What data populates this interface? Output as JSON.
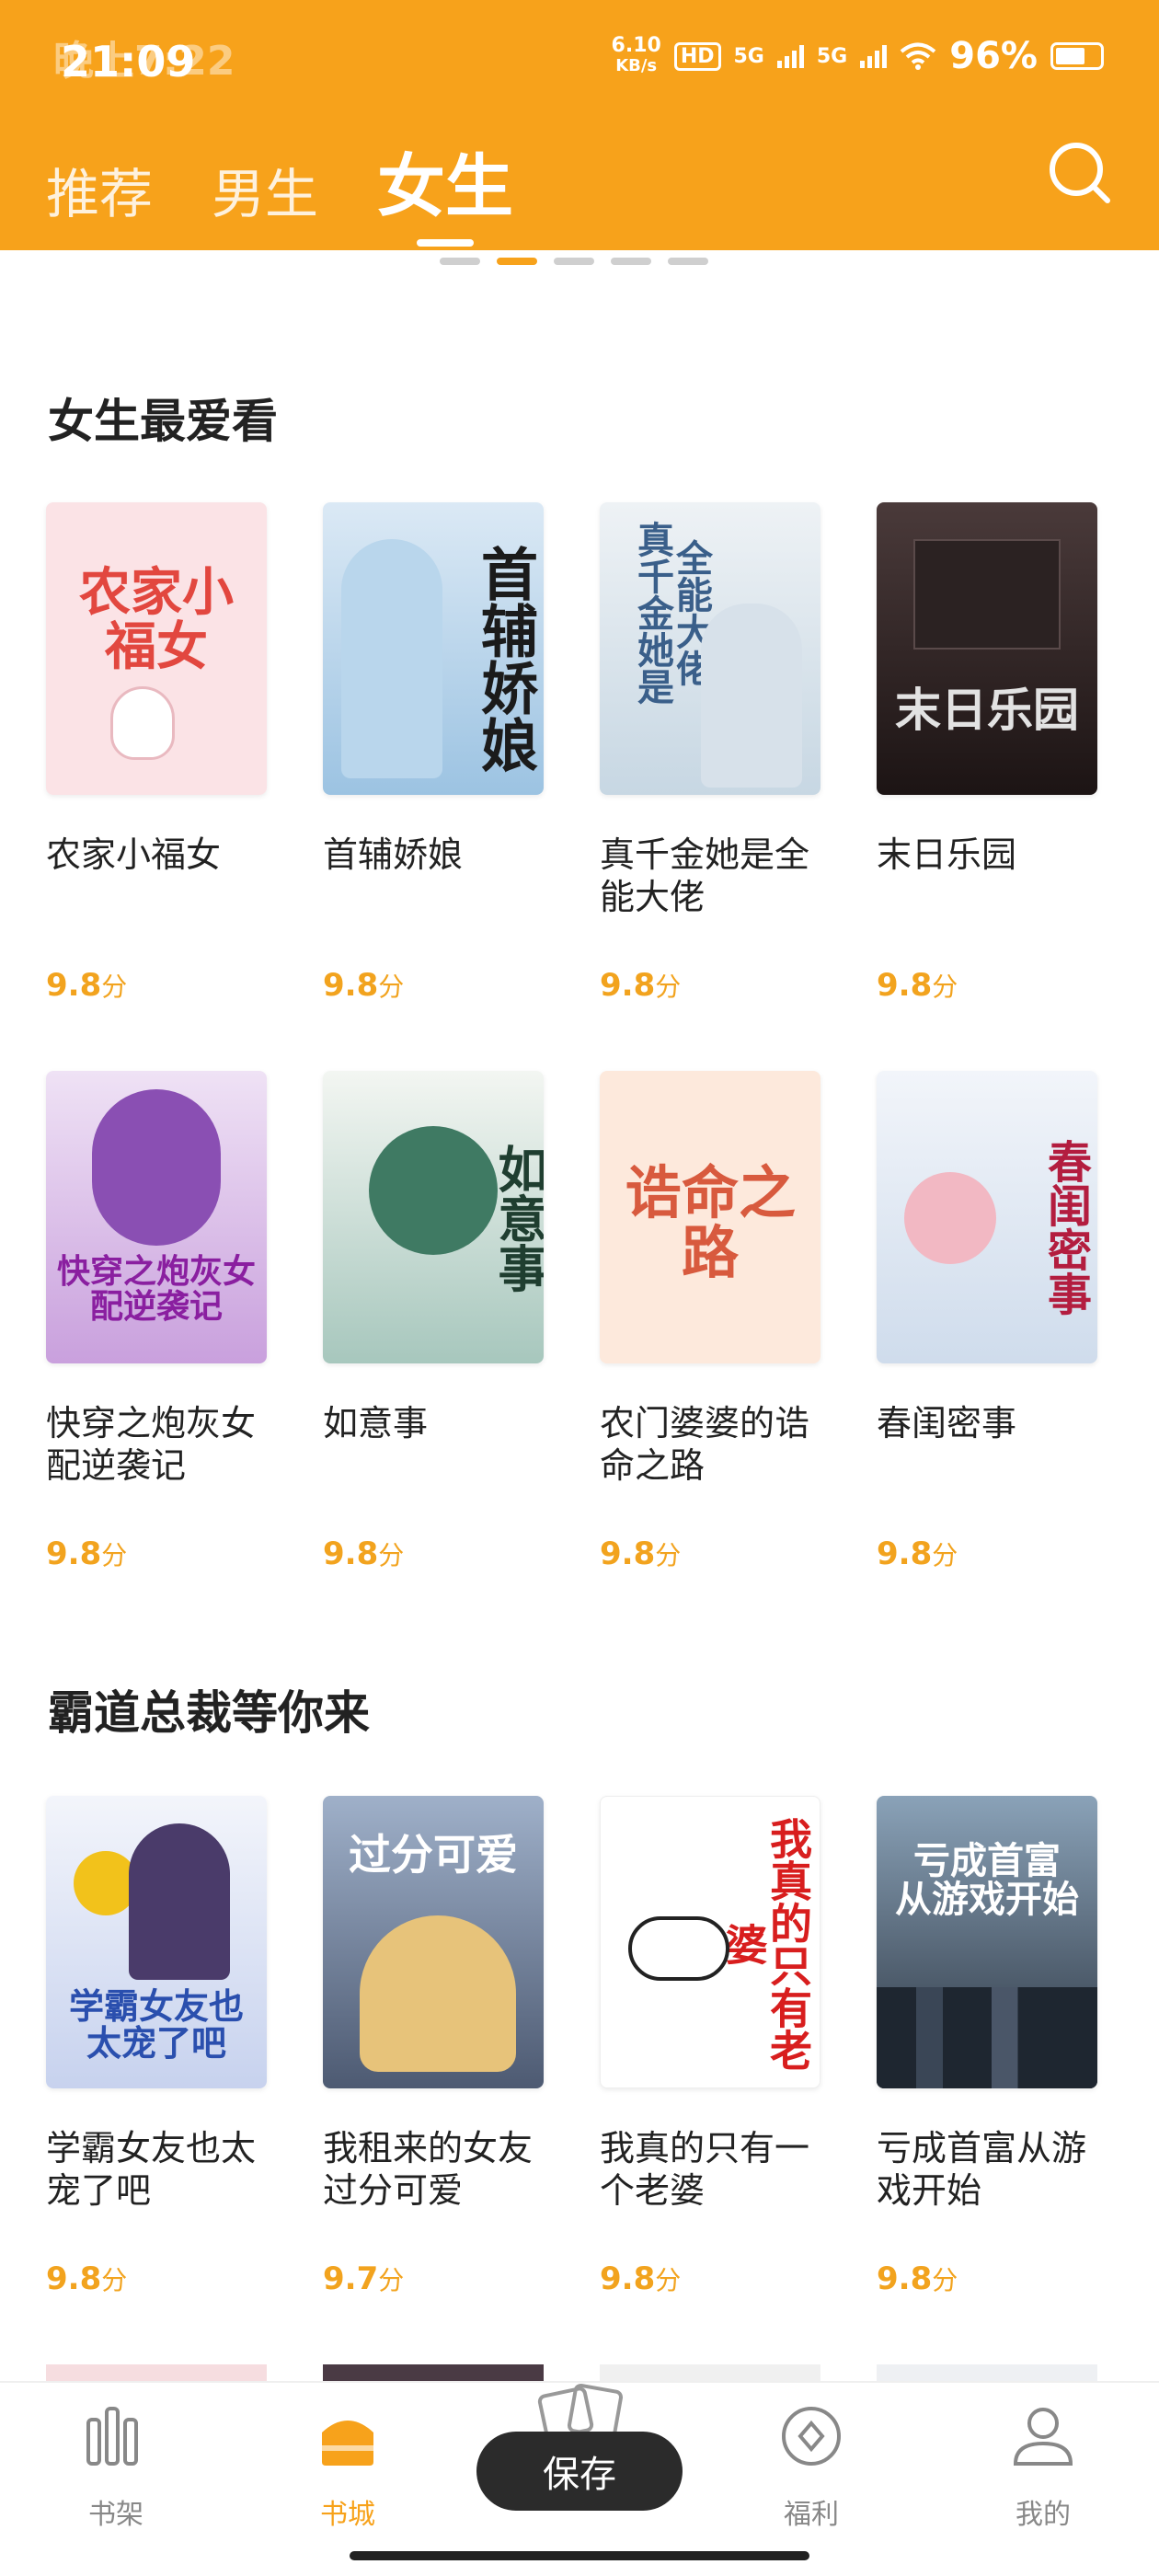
{
  "status_bar": {
    "time": "21:09",
    "ghost_time": "晚上7:22",
    "speed_value": "6.10",
    "speed_unit": "KB/s",
    "hd": "HD",
    "net1": "5G",
    "net2": "5G",
    "battery": "96%"
  },
  "top_tabs": [
    {
      "label": "推荐",
      "active": false
    },
    {
      "label": "男生",
      "active": false
    },
    {
      "label": "女生",
      "active": true
    }
  ],
  "carousel_dots": {
    "count": 5,
    "active_index": 1
  },
  "sections": [
    {
      "title": "女生最爱看",
      "books": [
        {
          "title": "农家小福女",
          "score": "9.8",
          "unit": "分",
          "cover_text": "农家小福女",
          "cover_bg": "#fbe3e6",
          "cover_fg": "#e2473f"
        },
        {
          "title": "首辅娇娘",
          "score": "9.8",
          "unit": "分",
          "cover_text": "首辅娇娘",
          "cover_bg": "#cfe3f2",
          "cover_fg": "#1b1b1b"
        },
        {
          "title": "真千金她是全能大佬",
          "score": "9.8",
          "unit": "分",
          "cover_text": "全能大佬 真千金她是",
          "cover_bg": "#dfe8ef",
          "cover_fg": "#3a5f8a"
        },
        {
          "title": "末日乐园",
          "score": "9.8",
          "unit": "分",
          "cover_text": "末日乐园",
          "cover_bg": "#2a2020",
          "cover_fg": "#e2e2e2"
        },
        {
          "title": "快穿之炮灰女配逆袭记",
          "score": "9.8",
          "unit": "分",
          "cover_text": "快穿之炮灰女配逆袭记",
          "cover_bg": "#e7d3ef",
          "cover_fg": "#8a1fa0"
        },
        {
          "title": "如意事",
          "score": "9.8",
          "unit": "分",
          "cover_text": "如意事",
          "cover_bg": "#e9eee8",
          "cover_fg": "#2f5a44"
        },
        {
          "title": "农门婆婆的诰命之路",
          "score": "9.8",
          "unit": "分",
          "cover_text": "诰命之路",
          "cover_bg": "#fde9dc",
          "cover_fg": "#d85a3e"
        },
        {
          "title": "春闺密事",
          "score": "9.8",
          "unit": "分",
          "cover_text": "春闺密事",
          "cover_bg": "#e7eef6",
          "cover_fg": "#b31d3f"
        }
      ]
    },
    {
      "title": "霸道总裁等你来",
      "books": [
        {
          "title": "学霸女友也太宠了吧",
          "score": "9.8",
          "unit": "分",
          "cover_text": "学霸女友也太宠了吧",
          "cover_bg": "#e3e7f5",
          "cover_fg": "#2a4fae"
        },
        {
          "title": "我租来的女友过分可爱",
          "score": "9.7",
          "unit": "分",
          "cover_text": "过分可爱",
          "cover_bg": "#b9c4d8",
          "cover_fg": "#2462c8"
        },
        {
          "title": "我真的只有一个老婆",
          "score": "9.8",
          "unit": "分",
          "cover_text": "我真的只有老婆",
          "cover_bg": "#ffffff",
          "cover_fg": "#d81e1e"
        },
        {
          "title": "亏成首富从游戏开始",
          "score": "9.8",
          "unit": "分",
          "cover_text": "亏成首富 从游戏开始",
          "cover_bg": "#3c4a5a",
          "cover_fg": "#ffffff"
        }
      ]
    }
  ],
  "bottom_nav": [
    {
      "label": "书架",
      "icon": "bookshelf-icon",
      "active": false
    },
    {
      "label": "书城",
      "icon": "bookstore-icon",
      "active": true
    },
    {
      "label": "福利",
      "icon": "welfare-icon",
      "active": false
    },
    {
      "label": "我的",
      "icon": "profile-icon",
      "active": false
    }
  ],
  "save_button": "保存",
  "colors": {
    "accent": "#F7A21B",
    "score": "#F2A31E",
    "text": "#222222"
  }
}
